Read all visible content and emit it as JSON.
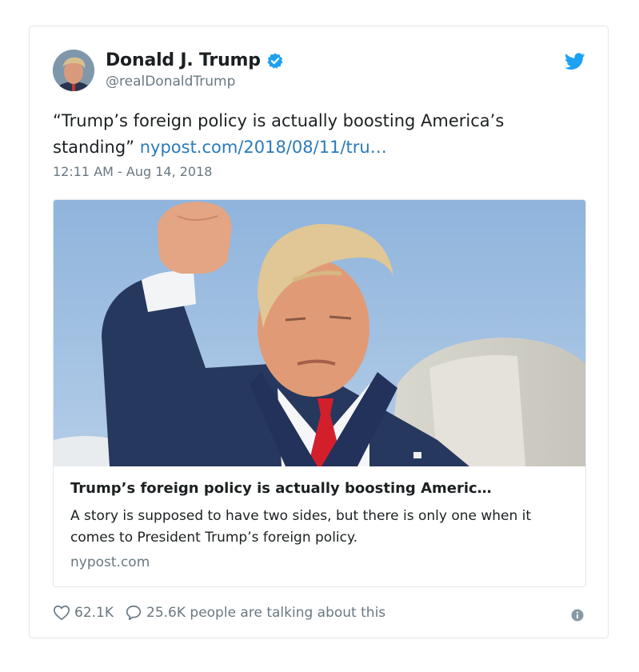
{
  "author": {
    "name": "Donald J. Trump",
    "handle": "@realDonaldTrump",
    "avatar_icon": "avatar-photo",
    "verified_icon": "verified-badge-icon"
  },
  "tweet": {
    "text": "“Trump’s foreign policy is actually boosting America’s standing” ",
    "link_text": "nypost.com/2018/08/11/tru…",
    "timestamp": "12:11 AM - Aug 14, 2018"
  },
  "link_card": {
    "title": "Trump’s foreign policy is actually boosting Americ…",
    "description": "A story is supposed to have  two sides, but there is only one when it comes to President Trump’s foreign policy.",
    "domain": "nypost.com"
  },
  "actions": {
    "likes": "62.1K",
    "talking": "25.6K people are talking about this"
  },
  "colors": {
    "accent": "#1da1f2",
    "link": "#2b7bb9",
    "text": "#1c2022",
    "muted": "#697882",
    "border": "#e1e8ed"
  }
}
